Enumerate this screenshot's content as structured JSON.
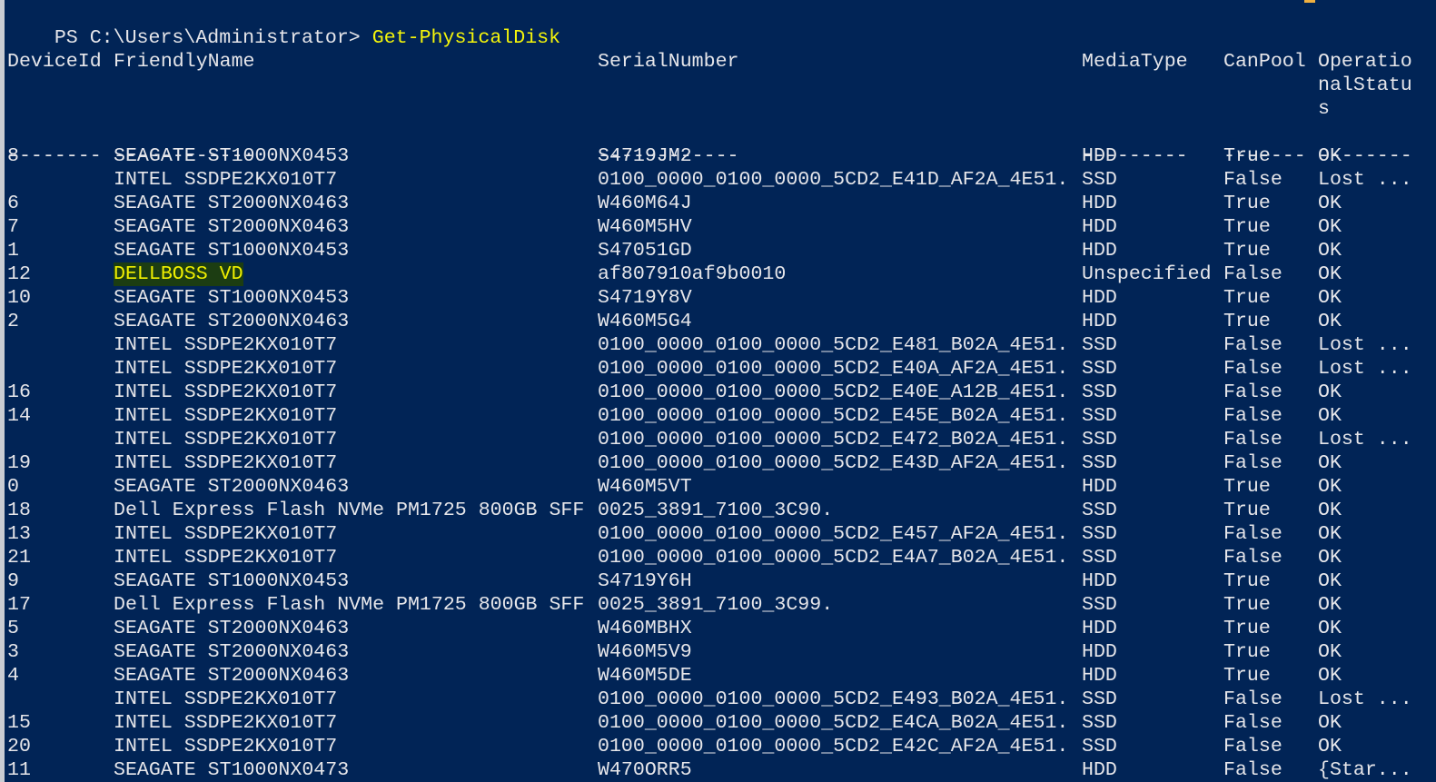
{
  "prompt": {
    "path": "PS C:\\Users\\Administrator> ",
    "command": "Get-PhysicalDisk"
  },
  "columns": [
    {
      "key": "id",
      "label": "DeviceId",
      "dashes": "--------",
      "col": 0
    },
    {
      "key": "name",
      "label": "FriendlyName",
      "dashes": "------------",
      "col": 9
    },
    {
      "key": "serial",
      "label": "SerialNumber",
      "dashes": "------------",
      "col": 50
    },
    {
      "key": "media",
      "label": "MediaType",
      "dashes": "---------",
      "col": 91
    },
    {
      "key": "pool",
      "label": "CanPool",
      "dashes": "-------",
      "col": 103
    },
    {
      "key": "status",
      "label": "Operatio\nnalStatu\ns",
      "dashes": "--------",
      "col": 111
    }
  ],
  "rows": [
    {
      "id": "8",
      "name": "SEAGATE ST1000NX0453",
      "serial": "S4719JM2",
      "media": "HDD",
      "pool": "True",
      "status": "OK"
    },
    {
      "id": "",
      "name": "INTEL SSDPE2KX010T7",
      "serial": "0100_0000_0100_0000_5CD2_E41D_AF2A_4E51.",
      "media": "SSD",
      "pool": "False",
      "status": "Lost ..."
    },
    {
      "id": "6",
      "name": "SEAGATE ST2000NX0463",
      "serial": "W460M64J",
      "media": "HDD",
      "pool": "True",
      "status": "OK"
    },
    {
      "id": "7",
      "name": "SEAGATE ST2000NX0463",
      "serial": "W460M5HV",
      "media": "HDD",
      "pool": "True",
      "status": "OK"
    },
    {
      "id": "1",
      "name": "SEAGATE ST1000NX0453",
      "serial": "S47051GD",
      "media": "HDD",
      "pool": "True",
      "status": "OK"
    },
    {
      "id": "12",
      "name": "DELLBOSS VD",
      "serial": "af807910af9b0010",
      "media": "Unspecified",
      "pool": "False",
      "status": "OK",
      "highlight": true
    },
    {
      "id": "10",
      "name": "SEAGATE ST1000NX0453",
      "serial": "S4719Y8V",
      "media": "HDD",
      "pool": "True",
      "status": "OK"
    },
    {
      "id": "2",
      "name": "SEAGATE ST2000NX0463",
      "serial": "W460M5G4",
      "media": "HDD",
      "pool": "True",
      "status": "OK"
    },
    {
      "id": "",
      "name": "INTEL SSDPE2KX010T7",
      "serial": "0100_0000_0100_0000_5CD2_E481_B02A_4E51.",
      "media": "SSD",
      "pool": "False",
      "status": "Lost ..."
    },
    {
      "id": "",
      "name": "INTEL SSDPE2KX010T7",
      "serial": "0100_0000_0100_0000_5CD2_E40A_AF2A_4E51.",
      "media": "SSD",
      "pool": "False",
      "status": "Lost ..."
    },
    {
      "id": "16",
      "name": "INTEL SSDPE2KX010T7",
      "serial": "0100_0000_0100_0000_5CD2_E40E_A12B_4E51.",
      "media": "SSD",
      "pool": "False",
      "status": "OK"
    },
    {
      "id": "14",
      "name": "INTEL SSDPE2KX010T7",
      "serial": "0100_0000_0100_0000_5CD2_E45E_B02A_4E51.",
      "media": "SSD",
      "pool": "False",
      "status": "OK"
    },
    {
      "id": "",
      "name": "INTEL SSDPE2KX010T7",
      "serial": "0100_0000_0100_0000_5CD2_E472_B02A_4E51.",
      "media": "SSD",
      "pool": "False",
      "status": "Lost ..."
    },
    {
      "id": "19",
      "name": "INTEL SSDPE2KX010T7",
      "serial": "0100_0000_0100_0000_5CD2_E43D_AF2A_4E51.",
      "media": "SSD",
      "pool": "False",
      "status": "OK"
    },
    {
      "id": "0",
      "name": "SEAGATE ST2000NX0463",
      "serial": "W460M5VT",
      "media": "HDD",
      "pool": "True",
      "status": "OK"
    },
    {
      "id": "18",
      "name": "Dell Express Flash NVMe PM1725 800GB SFF",
      "serial": "0025_3891_7100_3C90.",
      "media": "SSD",
      "pool": "True",
      "status": "OK"
    },
    {
      "id": "13",
      "name": "INTEL SSDPE2KX010T7",
      "serial": "0100_0000_0100_0000_5CD2_E457_AF2A_4E51.",
      "media": "SSD",
      "pool": "False",
      "status": "OK"
    },
    {
      "id": "21",
      "name": "INTEL SSDPE2KX010T7",
      "serial": "0100_0000_0100_0000_5CD2_E4A7_B02A_4E51.",
      "media": "SSD",
      "pool": "False",
      "status": "OK"
    },
    {
      "id": "9",
      "name": "SEAGATE ST1000NX0453",
      "serial": "S4719Y6H",
      "media": "HDD",
      "pool": "True",
      "status": "OK"
    },
    {
      "id": "17",
      "name": "Dell Express Flash NVMe PM1725 800GB SFF",
      "serial": "0025_3891_7100_3C99.",
      "media": "SSD",
      "pool": "True",
      "status": "OK"
    },
    {
      "id": "5",
      "name": "SEAGATE ST2000NX0463",
      "serial": "W460MBHX",
      "media": "HDD",
      "pool": "True",
      "status": "OK"
    },
    {
      "id": "3",
      "name": "SEAGATE ST2000NX0463",
      "serial": "W460M5V9",
      "media": "HDD",
      "pool": "True",
      "status": "OK"
    },
    {
      "id": "4",
      "name": "SEAGATE ST2000NX0463",
      "serial": "W460M5DE",
      "media": "HDD",
      "pool": "True",
      "status": "OK"
    },
    {
      "id": "",
      "name": "INTEL SSDPE2KX010T7",
      "serial": "0100_0000_0100_0000_5CD2_E493_B02A_4E51.",
      "media": "SSD",
      "pool": "False",
      "status": "Lost ..."
    },
    {
      "id": "15",
      "name": "INTEL SSDPE2KX010T7",
      "serial": "0100_0000_0100_0000_5CD2_E4CA_B02A_4E51.",
      "media": "SSD",
      "pool": "False",
      "status": "OK"
    },
    {
      "id": "20",
      "name": "INTEL SSDPE2KX010T7",
      "serial": "0100_0000_0100_0000_5CD2_E42C_AF2A_4E51.",
      "media": "SSD",
      "pool": "False",
      "status": "OK"
    },
    {
      "id": "11",
      "name": "SEAGATE ST1000NX0473",
      "serial": "W470ORR5",
      "media": "HDD",
      "pool": "False",
      "status": "{Star..."
    }
  ],
  "colors": {
    "background": "#012456",
    "text": "#e6e6ea",
    "command": "#f5f50a",
    "highlight_bg": "#1c3d12"
  }
}
